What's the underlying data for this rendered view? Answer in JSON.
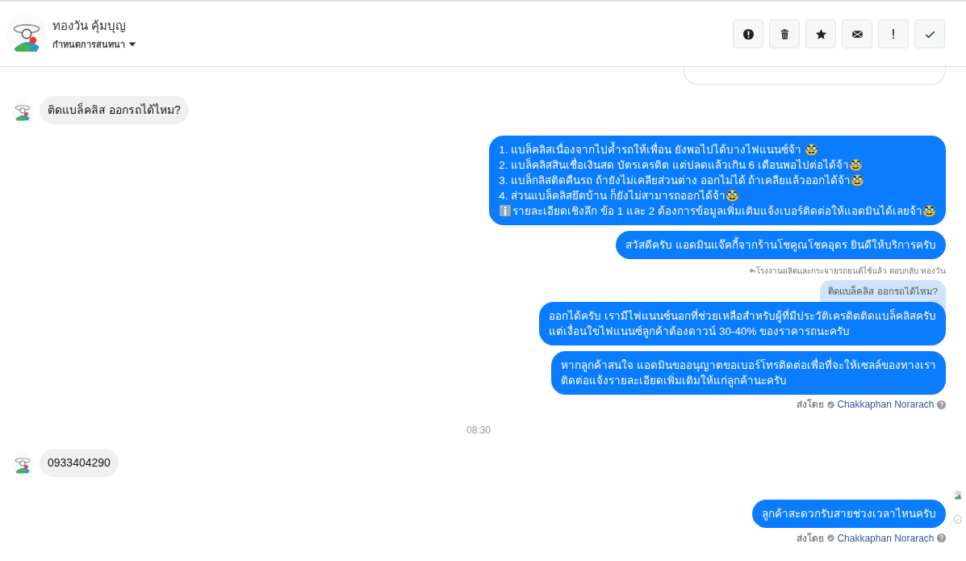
{
  "header": {
    "name": "ทองวัน คุ้มบุญ",
    "subtitle": "กำหนดการสนทนา"
  },
  "messages": [
    {
      "kind": "clipped"
    },
    {
      "kind": "incoming",
      "lines": [
        "ติดแบล็คลิส ออกรถได้ไหม?"
      ]
    },
    {
      "kind": "outgoing",
      "lines": [
        "1. แบล็คลิสเนื่องจากไปค้ำรถให้เพื่อน ยังพอไปได้บางไฟแนนซ์จ้า 🥸",
        "2. แบล็คลิสสินเชื่อเงินสด บัตรเครดิต แต่ปลดแล้วเกิน 6 เดือนพอไปต่อได้จ้า🥸",
        "3. แบล็กลิสติดคืนรถ ถ้ายังไม่เคลียส่วนต่าง ออกไม่ได้ ถ้าเคลียแล้วออกได้จ้า🥸",
        "4. ส่วนแบล็คลิสยึดบ้าน ก็ยังไม่สามารถออกได้จ้า🥸",
        "ℹ️รายละเอียดเชิงลึก ข้อ 1 และ 2 ต้องการข้อมูลเพิ่มเติมแจ้งเบอร์ติดต่อให้แอดมินได้เลยจ้า🥸"
      ]
    },
    {
      "kind": "outgoing",
      "lines": [
        "สวัสดีครับ แอดมินแจ๊คกี้จากร้านโชคูณโชคอุดร ยินดีให้บริการครับ"
      ]
    },
    {
      "kind": "outgoing",
      "reply": {
        "label": "โรงงานผลิตและกระจายรถยนต์ใช้แล้ว ตอบกลับ ทองวัน",
        "quote": "ติดแบล็คลิส ออกรถได้ไหม?"
      },
      "lines": [
        "ออกได้ครับ เรามีไฟแนนซ์นอกที่ช่วยเหลือสำหรับผู้ที่มีประวัติเครดิตติดแบล็คลิสครับ",
        "แต่เงื่อนใขไฟแนนซ์ลูกค้าต้องดาวน์ 30-40% ของราคารถนะครับ"
      ]
    },
    {
      "kind": "outgoing",
      "lines": [
        "หากลูกค้าสนใจ แอดมินขออนุญาตขอเบอร์โทรติดต่อเพื่อที่จะให้เซลล์ของทางเรา",
        "ติดต่อแจ้งรายละเอียดเพิ่มเติมให้แก่ลูกค้านะครับ"
      ],
      "sent_by": {
        "label": "ส่งโดย",
        "name": "Chakkaphan Norarach"
      }
    },
    {
      "kind": "time",
      "text": "08:30"
    },
    {
      "kind": "incoming",
      "lines": [
        "0933404290"
      ]
    },
    {
      "kind": "outgoing",
      "seen": true,
      "delivered": true,
      "lines": [
        "ลูกค้าสะดวกรับสายช่วงเวลาไหนครับ"
      ],
      "sent_by": {
        "label": "ส่งโดย",
        "name": "Chakkaphan Norarach"
      }
    }
  ]
}
